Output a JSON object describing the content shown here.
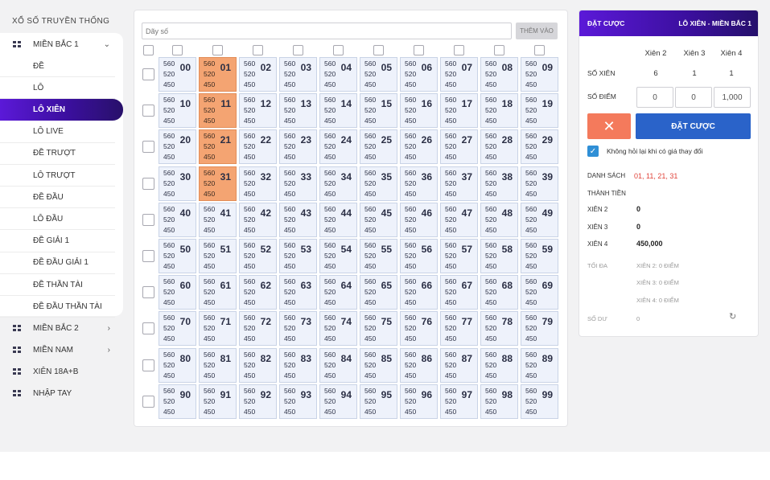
{
  "sidebar": {
    "title": "XỔ SỐ TRUYỀN THỐNG",
    "groups": [
      {
        "label": "MIỀN BẮC 1",
        "chevron": "⌄"
      },
      {
        "label": "MIỀN BẮC 2",
        "chevron": "›"
      },
      {
        "label": "MIỀN NAM",
        "chevron": "›"
      },
      {
        "label": "XIÊN 18A+B",
        "chevron": ""
      },
      {
        "label": "NHẬP TAY",
        "chevron": ""
      }
    ],
    "items": [
      {
        "label": "ĐỀ",
        "active": false
      },
      {
        "label": "LÔ",
        "active": false
      },
      {
        "label": "LÔ XIÊN",
        "active": true
      },
      {
        "label": "LÔ LIVE",
        "active": false
      },
      {
        "label": "ĐỀ TRƯỢT",
        "active": false
      },
      {
        "label": "LÔ TRƯỢT",
        "active": false
      },
      {
        "label": "ĐỀ ĐẦU",
        "active": false
      },
      {
        "label": "LÔ ĐẦU",
        "active": false
      },
      {
        "label": "ĐỀ GIẢI 1",
        "active": false
      },
      {
        "label": "ĐỀ ĐẦU GIẢI 1",
        "active": false
      },
      {
        "label": "ĐỀ THẦN TÀI",
        "active": false
      },
      {
        "label": "ĐỀ ĐẦU THẦN TÀI",
        "active": false
      }
    ]
  },
  "center": {
    "input_placeholder": "Dãy số",
    "add_button": "THÊM VÀO",
    "cell_prices": [
      "560",
      "520",
      "450"
    ],
    "selected_numbers": [
      "01",
      "11",
      "21",
      "31"
    ]
  },
  "right": {
    "header_left": "ĐẶT CƯỢC",
    "header_right": "LÔ XIÊN - MIỀN BẮC 1",
    "columns": [
      "Xiên 2",
      "Xiên 3",
      "Xiên 4"
    ],
    "so_xien_label": "SỐ XIÊN",
    "so_xien_values": [
      "6",
      "1",
      "1"
    ],
    "so_diem_label": "SỐ ĐIỂM",
    "so_diem_values": [
      "0",
      "0",
      "1,000"
    ],
    "cancel_icon": "close-icon",
    "bet_button": "ĐẶT CƯỢC",
    "checkbox_label": "Không hỏi lại khi có giá thay đổi",
    "checkbox_checked": true,
    "danh_sach_label": "DANH SÁCH",
    "danh_sach_value": "01, 11, 21, 31",
    "thanh_tien_label": "THÀNH TIỀN",
    "totals": [
      {
        "label": "XIÊN 2",
        "value": "0"
      },
      {
        "label": "XIÊN 3",
        "value": "0"
      },
      {
        "label": "XIÊN 4",
        "value": "450,000"
      }
    ],
    "toi_da_label": "TỐI ĐA",
    "toi_da_values": [
      "XIÊN 2: 0 ĐIỂM",
      "XIÊN 3: 0 ĐIỂM",
      "XIÊN 4: 0 ĐIỂM"
    ],
    "so_du_label": "SỐ DƯ",
    "so_du_value": "0",
    "refresh_icon": "refresh-icon"
  },
  "colors": {
    "accent_purple": "#4a13b8",
    "selected_cell": "#f4a472",
    "cell_bg": "#eef2fb",
    "bet_blue": "#2a63c9",
    "cancel_orange": "#f47a5c",
    "list_red": "#e0433a"
  }
}
